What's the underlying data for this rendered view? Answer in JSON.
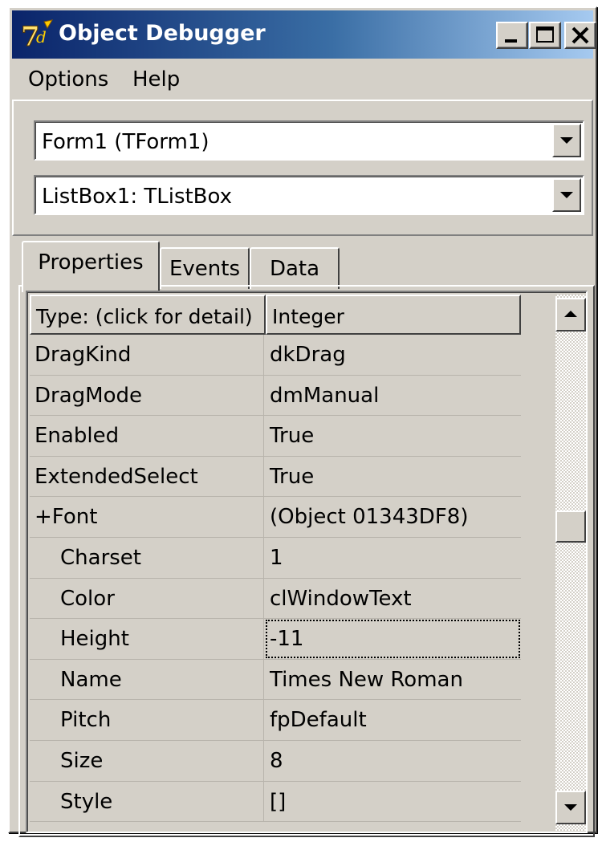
{
  "window": {
    "title": "Object Debugger",
    "icon": "delphi-app-icon",
    "controls": {
      "minimize": "minimize-icon",
      "maximize": "maximize-icon",
      "close": "close-icon"
    }
  },
  "menu": {
    "items": [
      "Options",
      "Help"
    ]
  },
  "selectors": {
    "form": "Form1 (TForm1)",
    "component": "ListBox1: TListBox"
  },
  "tabs": [
    {
      "label": "Properties",
      "active": true
    },
    {
      "label": "Events",
      "active": false
    },
    {
      "label": "Data",
      "active": false
    }
  ],
  "grid": {
    "header": {
      "name": "Type: (click for detail)",
      "value": "Integer"
    },
    "rows": [
      {
        "name": "DragKind",
        "value": "dkDrag",
        "indent": false
      },
      {
        "name": "DragMode",
        "value": "dmManual",
        "indent": false
      },
      {
        "name": "Enabled",
        "value": "True",
        "indent": false
      },
      {
        "name": "ExtendedSelect",
        "value": "True",
        "indent": false
      },
      {
        "name": "+Font",
        "value": "(Object 01343DF8)",
        "indent": false
      },
      {
        "name": "Charset",
        "value": "1",
        "indent": true
      },
      {
        "name": "Color",
        "value": "clWindowText",
        "indent": true
      },
      {
        "name": "Height",
        "value": "-11",
        "indent": true,
        "focused": true
      },
      {
        "name": "Name",
        "value": "Times New Roman",
        "indent": true
      },
      {
        "name": "Pitch",
        "value": "fpDefault",
        "indent": true
      },
      {
        "name": "Size",
        "value": "8",
        "indent": true
      },
      {
        "name": "Style",
        "value": "[]",
        "indent": true
      }
    ]
  },
  "scrollbar": {
    "position": 0.42
  }
}
